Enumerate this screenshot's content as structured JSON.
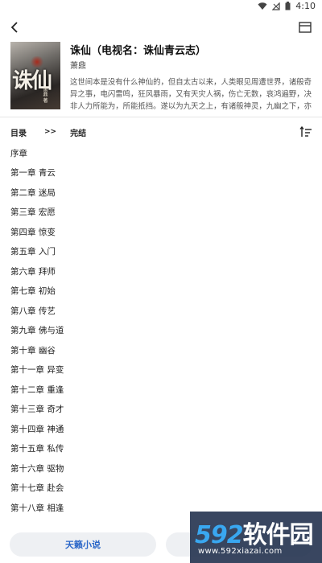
{
  "status_bar": {
    "time": "4:10"
  },
  "book": {
    "title": "诛仙（电视名：诛仙青云志）",
    "author": "萧鼎",
    "description": "这世间本是没有什么神仙的，但自太古以来，人类眼见周遭世界，诸般奇异之事，电闪雷鸣，狂风暴雨，又有天灾人祸，伤亡无数，哀鸿遍野，决非人力所能为，所能抵挡。遂以为九天之上，有诸般神灵，九幽之下，亦是阴魂归处，阎罗殿堂。",
    "cover": {
      "title": "诛仙",
      "author": "萧鼎 著"
    }
  },
  "breadcrumb": {
    "catalog": "目录",
    "separator": ">>",
    "status": "完结"
  },
  "chapters": [
    "序章",
    "第一章 青云",
    "第二章 迷局",
    "第三章 宏愿",
    "第四章 惊变",
    "第五章 入门",
    "第六章 拜师",
    "第七章 初始",
    "第八章 传艺",
    "第九章 佛与道",
    "第十章 幽谷",
    "第十一章 异变",
    "第十二章 重逢",
    "第十三章 奇才",
    "第十四章 神通",
    "第十五章 私传",
    "第十六章 驱物",
    "第十七章 赴会",
    "第十八章 相逢"
  ],
  "bottom": {
    "left_button": "天籁小说"
  },
  "watermark": {
    "logo_num": "592",
    "logo_text": "软件园",
    "url": "www.592xiazai.com"
  },
  "colors": {
    "accent": "#2a66c8",
    "button_bg": "#eef0f3",
    "watermark_bg": "#1e2c4a"
  },
  "icons": {
    "status": [
      "wifi-icon",
      "signal-icon",
      "battery-icon"
    ],
    "app_bar": [
      "back-arrow-icon",
      "reader-mode-icon"
    ],
    "sort": "sort-order-icon"
  }
}
